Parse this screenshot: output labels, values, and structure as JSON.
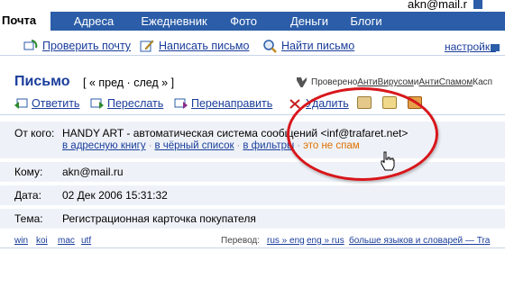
{
  "tabs": {
    "active": "Почта",
    "items": [
      "Адреса",
      "Ежедневник",
      "Фото",
      "Деньги",
      "Блоги"
    ]
  },
  "user": {
    "email": "akn@mail.r"
  },
  "toolbar": {
    "check_mail": "Проверить почту",
    "compose": "Написать письмо",
    "find_mail": "Найти письмо",
    "settings": "настройки"
  },
  "title": {
    "page_title": "Письмо",
    "nav_open": "[ « ",
    "prev": "пред",
    "dot": " · ",
    "next": "след",
    "nav_close": " » ]",
    "av_prefix": "Проверено ",
    "av_antivirus": "АнтиВирусом",
    "av_and": " и ",
    "av_antispam": "АнтиСпамом",
    "av_suffix": " Касп"
  },
  "actions": {
    "reply": "Ответить",
    "forward": "Переслать",
    "redirect": "Перенаправить",
    "delete": "Удалить"
  },
  "headers": {
    "from_label": "От кого:",
    "from_value": "HANDY ART - автоматическая система сообщений <inf@trafaret.net>",
    "link_addressbook": "в адресную книгу",
    "link_blacklist": "в чёрный список",
    "link_filters": "в фильтры",
    "not_spam": "это не спам",
    "to_label": "Кому:",
    "to_value": "akn@mail.ru",
    "date_label": "Дата:",
    "date_value": "02 Дек 2006 15:31:32",
    "subject_label": "Тема:",
    "subject_value": "Регистрационная карточка покупателя"
  },
  "encodings": [
    "win",
    "koi",
    "mac",
    "utf"
  ],
  "translate": {
    "label": "Перевод:",
    "rus_eng": "rus » eng",
    "eng_rus": "eng » rus",
    "more": "больше языков и словарей — Tra"
  },
  "colors": {
    "tab_band": "#2b5da8",
    "link": "#1a3d9b",
    "highlight": "#d8161b",
    "not_spam": "#e07000",
    "header_bg": "#eef2f8"
  }
}
